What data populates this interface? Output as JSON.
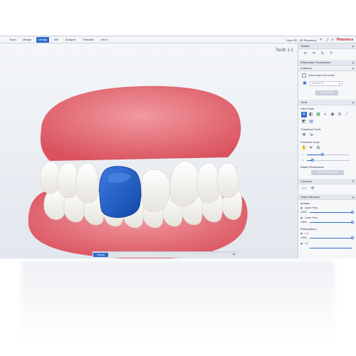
{
  "tabs": [
    "Scan",
    "Margin",
    "Design",
    "Mill",
    "Analyze",
    "Simulate",
    "Send"
  ],
  "active_tab": "Design",
  "topbar_right": {
    "user_text": "View 3D · 3D Planmeca",
    "brand": "Planmeca"
  },
  "viewport": {
    "tooth_label": "Tooth 1-1"
  },
  "scans_bar": {
    "button": "Scans",
    "caret": "▲"
  },
  "sidebar": {
    "utilities": {
      "title": "Utilities",
      "caret": "▲"
    },
    "restoration_parameters": {
      "title": "Restoration Parameters",
      "caret": "▲"
    },
    "anatomy": {
      "title": "Anatomy",
      "caret": "▲",
      "checkbox_label": "Select tooth from model",
      "dropdown": "Anterior A1",
      "button": "Place Tooth"
    },
    "tools": {
      "title": "Tools",
      "caret": "▲",
      "view_tools": "View Tools",
      "transform_tools": "Transform Tools",
      "freeform_tools": "Freeform Tools"
    },
    "attach": {
      "title": "Attach Restoration",
      "button": "Attach Restoration"
    },
    "contacts": {
      "title": "Contacts",
      "caret": "▼"
    },
    "object_browser": {
      "title": "Object Browser",
      "caret": "▲",
      "models_label": "Models",
      "models": [
        {
          "name": "Upper Prep",
          "opacity": "100%",
          "level": 1.0
        },
        {
          "name": "Lower Prep",
          "opacity": "100%",
          "level": 1.0
        }
      ],
      "restorations_label": "Restorations",
      "restorations": [
        {
          "name": "1-1",
          "opacity": "100%",
          "level": 1.0
        },
        {
          "name": "1-2",
          "opacity": "",
          "level": 1.0
        }
      ]
    }
  },
  "colors": {
    "accent": "#2d6cc8",
    "gum": "#e6737c",
    "tooth": "#f4f3ee",
    "restoration": "#1f5fc9",
    "brand": "#c9202f"
  }
}
